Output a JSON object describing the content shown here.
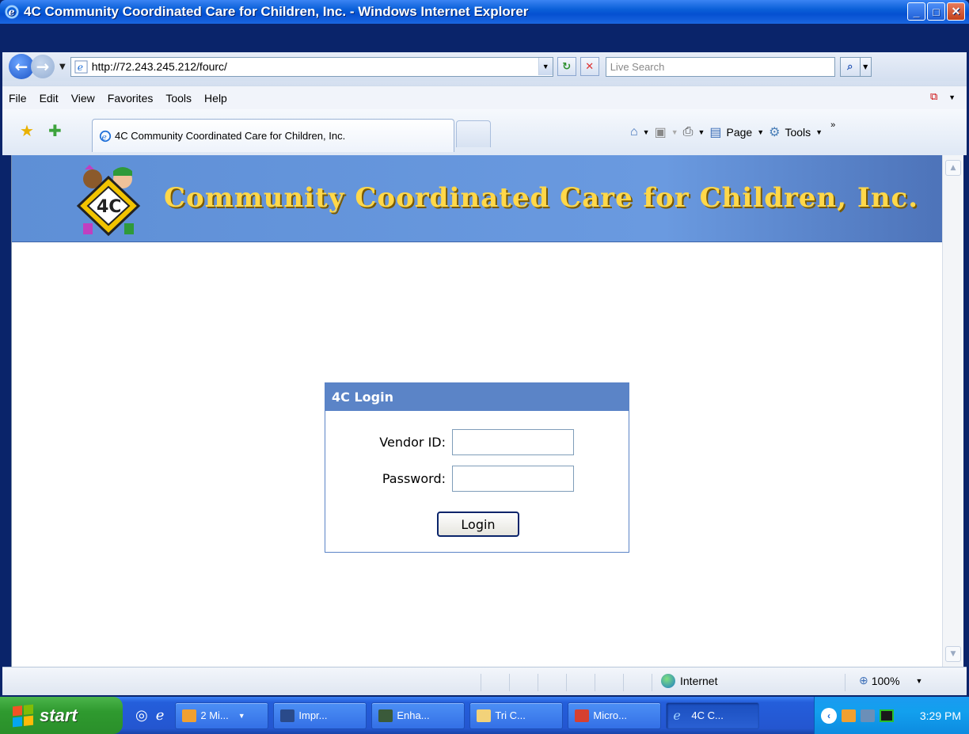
{
  "window": {
    "title": "4C Community Coordinated Care for Children, Inc. - Windows Internet Explorer"
  },
  "address_bar": {
    "url": "http://72.243.245.212/fourc/"
  },
  "search": {
    "placeholder": "Live Search"
  },
  "menu": {
    "items": [
      "File",
      "Edit",
      "View",
      "Favorites",
      "Tools",
      "Help"
    ]
  },
  "tab": {
    "label": "4C Community Coordinated Care for Children, Inc."
  },
  "command_bar": {
    "page_label": "Page",
    "tools_label": "Tools"
  },
  "banner": {
    "title": "Community Coordinated Care for Children, Inc.",
    "logo_text": "4C"
  },
  "login": {
    "header": "4C Login",
    "vendor_label": "Vendor ID:",
    "vendor_value": "",
    "password_label": "Password:",
    "password_value": "",
    "button_label": "Login"
  },
  "status_bar": {
    "zone": "Internet",
    "zoom": "100%"
  },
  "taskbar": {
    "start_label": "start",
    "buttons": [
      "2 Mi...",
      "Impr...",
      "Enha...",
      "Tri C...",
      "Micro...",
      "4C C..."
    ],
    "clock": "3:29 PM"
  },
  "colors": {
    "banner_blue": "#5e8fd6",
    "login_header": "#5b84c7",
    "banner_text": "#ffd84a"
  }
}
